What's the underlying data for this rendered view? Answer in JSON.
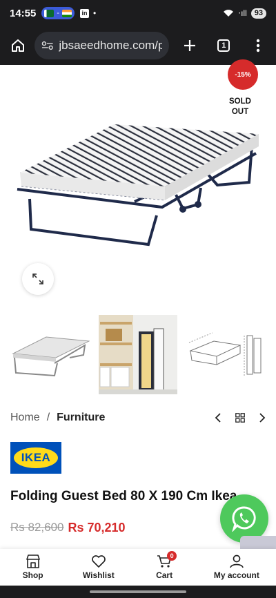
{
  "status_bar": {
    "time": "14:55",
    "chip_dash": "-",
    "linkedin": "in",
    "dot": "•",
    "signal_text": "⋅ıll",
    "battery": "93"
  },
  "browser": {
    "url": "jbsaeedhome.com/p",
    "tab_count": "1"
  },
  "product": {
    "sale_badge": "-15%",
    "sold_out": "SOLD OUT",
    "brand": "IKEA",
    "title": "Folding Guest Bed 80 X 190 Cm Ikea",
    "old_price": "Rs 82,600",
    "new_price": "Rs 70,210"
  },
  "breadcrumb": {
    "home": "Home",
    "separator": "/",
    "current": "Furniture"
  },
  "bottom_nav": {
    "shop": "Shop",
    "wishlist": "Wishlist",
    "cart": "Cart",
    "cart_count": "0",
    "account": "My account"
  },
  "colors": {
    "sale_red": "#d62b2b",
    "ikea_blue": "#0051ba",
    "ikea_yellow": "#ffda1a",
    "whatsapp_green": "#4ec95c"
  }
}
